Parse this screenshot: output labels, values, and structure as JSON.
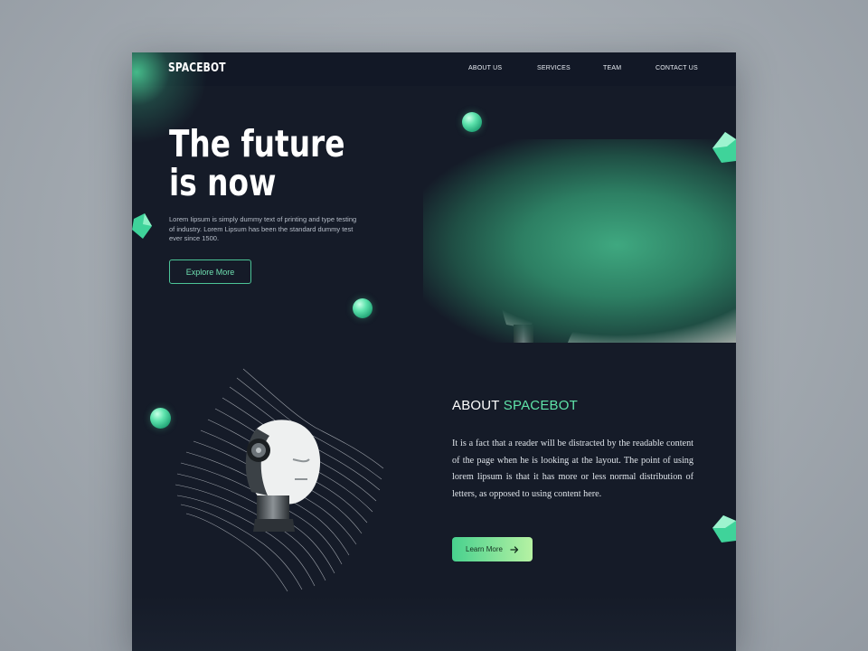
{
  "brand": {
    "logo": "SPACEBOT",
    "accent_color": "#5fe3a9"
  },
  "nav": {
    "items": [
      {
        "label": "ABOUT US"
      },
      {
        "label": "SERVICES"
      },
      {
        "label": "TEAM"
      },
      {
        "label": "CONTACT US"
      }
    ]
  },
  "hero": {
    "title_line1": "The future",
    "title_line2": "is now",
    "description": "Lorem Iipsum is simply dummy text of printing and type testing of industry. Lorem Lipsum has been the standard dummy test ever since 1500.",
    "button_label": "Explore More"
  },
  "about": {
    "title_prefix": "ABOUT",
    "title_accent": "SPACEBOT",
    "body": "It is a fact that a reader will be distracted by the readable content of the page when he is looking at the layout. The point of using lorem lipsum is that it has more or less normal distribution of letters, as opposed to using content here.",
    "button_label": "Learn More",
    "button_icon": "arrow-right-icon"
  },
  "colors": {
    "background": "#151b28",
    "nav_background": "#121826",
    "accent_green": "#4cc497",
    "button_gradient_start": "#48d18e",
    "button_gradient_end": "#b6f2a3"
  }
}
